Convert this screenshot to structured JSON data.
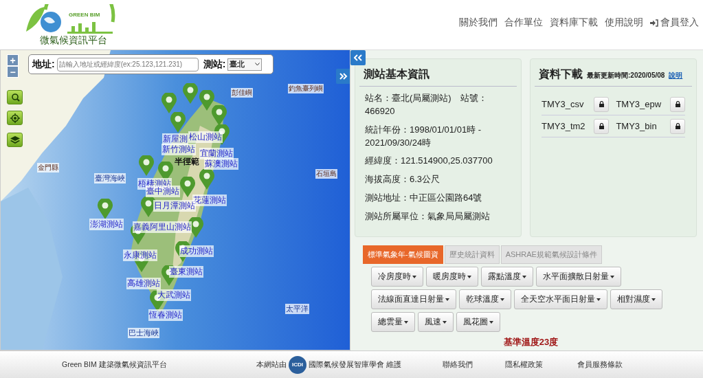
{
  "header": {
    "logo": {
      "brand": "GREEN BIM",
      "title": "微氣候資訊平台"
    },
    "nav": [
      {
        "label": "關於我們",
        "kind": "link"
      },
      {
        "label": "合作單位",
        "kind": "link"
      },
      {
        "label": "資料庫下載",
        "kind": "link"
      },
      {
        "label": "使用說明",
        "kind": "link"
      },
      {
        "label": "會員登入",
        "kind": "login"
      }
    ]
  },
  "map": {
    "search": {
      "label": "地址:",
      "placeholder": "請輸入地址或經緯度(ex:25.123,121.231)",
      "station_label": "測站:",
      "station_value": "臺北"
    },
    "zoom_in": "+",
    "zoom_out": "−",
    "places": [
      "釣魚臺列嶼",
      "彭佳嶼",
      "金門縣",
      "臺灣海峽",
      "石垣島",
      "太平洋",
      "巴士海峽"
    ],
    "radius_label": "半徑範",
    "stations": [
      "新屋測",
      "松山測站",
      "新竹測站",
      "宜蘭測站",
      "蘇澳測站",
      "梧棲測站",
      "臺中測站",
      "花蓮測站",
      "日月潭測站",
      "澎湖測站",
      "嘉義阿里山測站",
      "永康測站",
      "成功測站",
      "臺東測站",
      "高雄測站",
      "大武測站",
      "恆春測站"
    ]
  },
  "station_info": {
    "title": "測站基本資訊",
    "lines": [
      "站名：臺北(局屬測站)　站號：466920",
      "統計年份：1998/01/01/01時 - 2021/09/30/24時",
      "經緯度：121.514900,25.037700",
      "海拔高度：6.3公尺",
      "測站地址：中正區公園路64號",
      "測站所屬單位：氣象局局屬測站"
    ]
  },
  "download": {
    "title": "資料下載",
    "updated": "最新更新時間:2020/05/08",
    "help_link": "說明",
    "files": [
      "TMY3_csv",
      "TMY3_epw",
      "TMY3_tm2",
      "TMY3_bin"
    ]
  },
  "tabs": [
    {
      "label": "標準氣象年-氣候圖資",
      "selected": true
    },
    {
      "label": "歷史統計資料",
      "selected": false
    },
    {
      "label": "ASHRAE規範氣候設計條件",
      "selected": false
    }
  ],
  "chart_buttons": [
    [
      "冷房度時",
      "暖房度時",
      "露點溫度",
      "水平面擴散日射量"
    ],
    [
      "法線面直達日射量",
      "乾球溫度",
      "全天空水平面日射量",
      "相對濕度"
    ],
    [
      "總雲量",
      "風速",
      "風花圖"
    ]
  ],
  "base_temperature": "基準溫度23度",
  "footer": {
    "site_name": "Green BIM 建築微氣候資訊平台",
    "maintained_prefix": "本網站由",
    "org_logo": "ICDI",
    "maintained_by": "國際氣候發展智庫學會 維護",
    "links": [
      "聯絡我們",
      "隱私權政策",
      "會員服務條款"
    ]
  }
}
